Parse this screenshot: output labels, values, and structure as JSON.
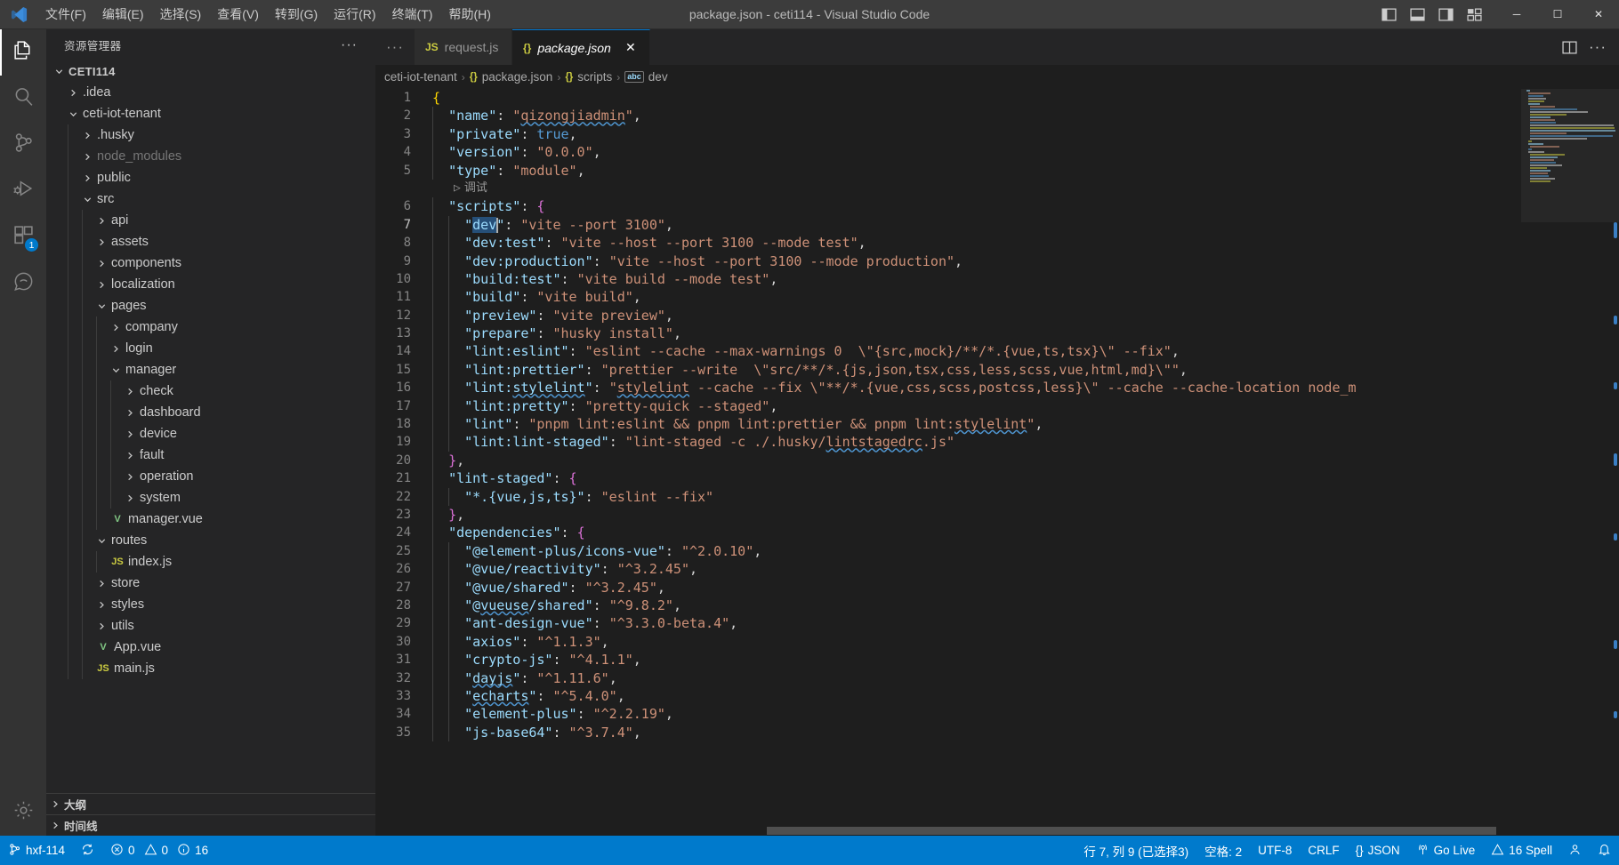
{
  "titlebar": {
    "logo_icon": "vscode-logo-icon",
    "menus": [
      "文件(F)",
      "编辑(E)",
      "选择(S)",
      "查看(V)",
      "转到(G)",
      "运行(R)",
      "终端(T)",
      "帮助(H)"
    ],
    "title": "package.json - ceti114 - Visual Studio Code",
    "layout_icons": [
      "toggle-primary-sidebar-icon",
      "toggle-panel-icon",
      "toggle-secondary-sidebar-icon",
      "customize-layout-icon"
    ],
    "window_controls": {
      "minimize": "─",
      "maximize": "☐",
      "close": "✕"
    }
  },
  "activitybar": {
    "items": [
      {
        "name": "explorer",
        "icon": "files-icon",
        "active": true,
        "badge": ""
      },
      {
        "name": "search",
        "icon": "search-icon",
        "active": false,
        "badge": ""
      },
      {
        "name": "source-control",
        "icon": "source-control-icon",
        "active": false,
        "badge": ""
      },
      {
        "name": "run-and-debug",
        "icon": "run-debug-icon",
        "active": false,
        "badge": ""
      },
      {
        "name": "extensions",
        "icon": "extensions-icon",
        "active": false,
        "badge": "1"
      },
      {
        "name": "copilot-chat",
        "icon": "copilot-icon",
        "active": false,
        "badge": ""
      }
    ],
    "bottom": [
      {
        "name": "manage",
        "icon": "gear-icon"
      }
    ]
  },
  "sidebar": {
    "header_title": "资源管理器",
    "more_actions": "···",
    "tree": [
      {
        "label": "CETI114",
        "depth": 0,
        "type": "root",
        "expanded": true
      },
      {
        "label": ".idea",
        "depth": 1,
        "type": "folder",
        "expanded": false
      },
      {
        "label": "ceti-iot-tenant",
        "depth": 1,
        "type": "folder",
        "expanded": true
      },
      {
        "label": ".husky",
        "depth": 2,
        "type": "folder",
        "expanded": false
      },
      {
        "label": "node_modules",
        "depth": 2,
        "type": "folder",
        "expanded": false,
        "dim": true
      },
      {
        "label": "public",
        "depth": 2,
        "type": "folder",
        "expanded": false
      },
      {
        "label": "src",
        "depth": 2,
        "type": "folder",
        "expanded": true
      },
      {
        "label": "api",
        "depth": 3,
        "type": "folder",
        "expanded": false
      },
      {
        "label": "assets",
        "depth": 3,
        "type": "folder",
        "expanded": false
      },
      {
        "label": "components",
        "depth": 3,
        "type": "folder",
        "expanded": false
      },
      {
        "label": "localization",
        "depth": 3,
        "type": "folder",
        "expanded": false
      },
      {
        "label": "pages",
        "depth": 3,
        "type": "folder",
        "expanded": true
      },
      {
        "label": "company",
        "depth": 4,
        "type": "folder",
        "expanded": false
      },
      {
        "label": "login",
        "depth": 4,
        "type": "folder",
        "expanded": false
      },
      {
        "label": "manager",
        "depth": 4,
        "type": "folder",
        "expanded": true
      },
      {
        "label": "check",
        "depth": 5,
        "type": "folder",
        "expanded": false
      },
      {
        "label": "dashboard",
        "depth": 5,
        "type": "folder",
        "expanded": false
      },
      {
        "label": "device",
        "depth": 5,
        "type": "folder",
        "expanded": false
      },
      {
        "label": "fault",
        "depth": 5,
        "type": "folder",
        "expanded": false
      },
      {
        "label": "operation",
        "depth": 5,
        "type": "folder",
        "expanded": false
      },
      {
        "label": "system",
        "depth": 5,
        "type": "folder",
        "expanded": false
      },
      {
        "label": "manager.vue",
        "depth": 4,
        "type": "vue"
      },
      {
        "label": "routes",
        "depth": 3,
        "type": "folder",
        "expanded": true
      },
      {
        "label": "index.js",
        "depth": 4,
        "type": "js"
      },
      {
        "label": "store",
        "depth": 3,
        "type": "folder",
        "expanded": false
      },
      {
        "label": "styles",
        "depth": 3,
        "type": "folder",
        "expanded": false
      },
      {
        "label": "utils",
        "depth": 3,
        "type": "folder",
        "expanded": false
      },
      {
        "label": "App.vue",
        "depth": 3,
        "type": "vue"
      },
      {
        "label": "main.js",
        "depth": 3,
        "type": "js"
      }
    ],
    "sections": [
      {
        "label": "大纲",
        "expanded": false
      },
      {
        "label": "时间线",
        "expanded": false
      }
    ]
  },
  "tabs": {
    "items": [
      {
        "label": "request.js",
        "icon": "js-file-icon",
        "active": false,
        "italic": false,
        "closable": false
      },
      {
        "label": "package.json",
        "icon": "json-file-icon",
        "active": true,
        "italic": true,
        "closable": true
      }
    ],
    "overflow": "···",
    "actions": [
      "split-editor-icon",
      "more-actions-icon"
    ]
  },
  "breadcrumb": {
    "segments": [
      {
        "label": "ceti-iot-tenant",
        "icon": ""
      },
      {
        "label": "package.json",
        "icon": "{}"
      },
      {
        "label": "scripts",
        "icon": "{}"
      },
      {
        "label": "dev",
        "icon": "abc"
      }
    ],
    "separator": "›"
  },
  "editor": {
    "codelens": {
      "label": "调试",
      "icon": "play-icon",
      "after_line": 5
    },
    "cursor": {
      "line": 7,
      "column": 9
    },
    "lines": [
      {
        "n": 1,
        "html": "<span class='br1'>{</span>"
      },
      {
        "n": 2,
        "html": "  <span class='k'>\"name\"</span><span class='p'>:</span> <span class='s'>\"<span class='sq'>qizongjiadmin</span>\"</span><span class='p'>,</span>"
      },
      {
        "n": 3,
        "html": "  <span class='k'>\"private\"</span><span class='p'>:</span> <span class='b'>true</span><span class='p'>,</span>"
      },
      {
        "n": 4,
        "html": "  <span class='k'>\"version\"</span><span class='p'>:</span> <span class='s'>\"0.0.0\"</span><span class='p'>,</span>"
      },
      {
        "n": 5,
        "html": "  <span class='k'>\"type\"</span><span class='p'>:</span> <span class='s'>\"module\"</span><span class='p'>,</span>"
      },
      {
        "n": 6,
        "html": "  <span class='k'>\"scripts\"</span><span class='p'>:</span> <span class='br2'>{</span>"
      },
      {
        "n": 7,
        "html": "    <span class='k'>\"<span class='sel'>dev</span>\"</span><span class='p'>:</span> <span class='s'>\"vite --port 3100\"</span><span class='p'>,</span>"
      },
      {
        "n": 8,
        "html": "    <span class='k'>\"dev:test\"</span><span class='p'>:</span> <span class='s'>\"vite --host --port 3100 --mode test\"</span><span class='p'>,</span>"
      },
      {
        "n": 9,
        "html": "    <span class='k'>\"dev:production\"</span><span class='p'>:</span> <span class='s'>\"vite --host --port 3100 --mode production\"</span><span class='p'>,</span>"
      },
      {
        "n": 10,
        "html": "    <span class='k'>\"build:test\"</span><span class='p'>:</span> <span class='s'>\"vite build --mode test\"</span><span class='p'>,</span>"
      },
      {
        "n": 11,
        "html": "    <span class='k'>\"build\"</span><span class='p'>:</span> <span class='s'>\"vite build\"</span><span class='p'>,</span>"
      },
      {
        "n": 12,
        "html": "    <span class='k'>\"preview\"</span><span class='p'>:</span> <span class='s'>\"vite preview\"</span><span class='p'>,</span>"
      },
      {
        "n": 13,
        "html": "    <span class='k'>\"prepare\"</span><span class='p'>:</span> <span class='s'>\"husky install\"</span><span class='p'>,</span>"
      },
      {
        "n": 14,
        "html": "    <span class='k'>\"lint:eslint\"</span><span class='p'>:</span> <span class='s'>\"eslint --cache --max-warnings 0  \\\"{src,mock}/**/*.{vue,ts,tsx}\\\" --fix\"</span><span class='p'>,</span>"
      },
      {
        "n": 15,
        "html": "    <span class='k'>\"lint:prettier\"</span><span class='p'>:</span> <span class='s'>\"prettier --write  \\\"src/**/*.{js,json,tsx,css,less,scss,vue,html,md}\\\"\"</span><span class='p'>,</span>"
      },
      {
        "n": 16,
        "html": "    <span class='k'>\"lint:<span class='sq'>stylelint</span>\"</span><span class='p'>:</span> <span class='s'>\"<span class='sq'>stylelint</span> --cache --fix \\\"**/*.{vue,css,scss,postcss,less}\\\" --cache --cache-location node_m</span>"
      },
      {
        "n": 17,
        "html": "    <span class='k'>\"lint:pretty\"</span><span class='p'>:</span> <span class='s'>\"pretty-quick --staged\"</span><span class='p'>,</span>"
      },
      {
        "n": 18,
        "html": "    <span class='k'>\"lint\"</span><span class='p'>:</span> <span class='s'>\"pnpm lint:eslint &amp;&amp; pnpm lint:prettier &amp;&amp; pnpm lint:<span class='sq'>stylelint</span>\"</span><span class='p'>,</span>"
      },
      {
        "n": 19,
        "html": "    <span class='k'>\"lint:lint-staged\"</span><span class='p'>:</span> <span class='s'>\"lint-staged -c ./.husky/<span class='sq'>lintstagedrc</span>.js\"</span>"
      },
      {
        "n": 20,
        "html": "  <span class='br2'>}</span><span class='p'>,</span>"
      },
      {
        "n": 21,
        "html": "  <span class='k'>\"lint-staged\"</span><span class='p'>:</span> <span class='br2'>{</span>"
      },
      {
        "n": 22,
        "html": "    <span class='k'>\"*.{vue,js,ts}\"</span><span class='p'>:</span> <span class='s'>\"eslint --fix\"</span>"
      },
      {
        "n": 23,
        "html": "  <span class='br2'>}</span><span class='p'>,</span>"
      },
      {
        "n": 24,
        "html": "  <span class='k'>\"dependencies\"</span><span class='p'>:</span> <span class='br2'>{</span>"
      },
      {
        "n": 25,
        "html": "    <span class='k'>\"@element-plus/icons-vue\"</span><span class='p'>:</span> <span class='s'>\"^2.0.10\"</span><span class='p'>,</span>"
      },
      {
        "n": 26,
        "html": "    <span class='k'>\"@vue/reactivity\"</span><span class='p'>:</span> <span class='s'>\"^3.2.45\"</span><span class='p'>,</span>"
      },
      {
        "n": 27,
        "html": "    <span class='k'>\"@vue/shared\"</span><span class='p'>:</span> <span class='s'>\"^3.2.45\"</span><span class='p'>,</span>"
      },
      {
        "n": 28,
        "html": "    <span class='k'>\"@<span class='sq'>vueuse</span>/shared\"</span><span class='p'>:</span> <span class='s'>\"^9.8.2\"</span><span class='p'>,</span>"
      },
      {
        "n": 29,
        "html": "    <span class='k'>\"ant-design-vue\"</span><span class='p'>:</span> <span class='s'>\"^3.3.0-beta.4\"</span><span class='p'>,</span>"
      },
      {
        "n": 30,
        "html": "    <span class='k'>\"axios\"</span><span class='p'>:</span> <span class='s'>\"^1.1.3\"</span><span class='p'>,</span>"
      },
      {
        "n": 31,
        "html": "    <span class='k'>\"crypto-js\"</span><span class='p'>:</span> <span class='s'>\"^4.1.1\"</span><span class='p'>,</span>"
      },
      {
        "n": 32,
        "html": "    <span class='k'>\"<span class='sq'>dayjs</span>\"</span><span class='p'>:</span> <span class='s'>\"^1.11.6\"</span><span class='p'>,</span>"
      },
      {
        "n": 33,
        "html": "    <span class='k'>\"<span class='sq'>echarts</span>\"</span><span class='p'>:</span> <span class='s'>\"^5.4.0\"</span><span class='p'>,</span>"
      },
      {
        "n": 34,
        "html": "    <span class='k'>\"element-plus\"</span><span class='p'>:</span> <span class='s'>\"^2.2.19\"</span><span class='p'>,</span>"
      },
      {
        "n": 35,
        "html": "    <span class='k'>\"js-base64\"</span><span class='p'>:</span> <span class='s'>\"^3.7.4\"</span><span class='p'>,</span>"
      }
    ]
  },
  "statusbar": {
    "left": [
      {
        "name": "remote-branch",
        "icon": "source-control-icon",
        "label": "hxf-114"
      },
      {
        "name": "sync",
        "icon": "sync-icon",
        "label": ""
      },
      {
        "name": "problems",
        "icon": "error-warning-info",
        "label": "0  0  16",
        "errors": "0",
        "warnings": "0",
        "infos": "16"
      }
    ],
    "right": [
      {
        "name": "editor-position",
        "label": "行 7, 列 9 (已选择3)"
      },
      {
        "name": "indentation",
        "label": "空格: 2"
      },
      {
        "name": "encoding",
        "label": "UTF-8"
      },
      {
        "name": "eol",
        "label": "CRLF"
      },
      {
        "name": "language-mode",
        "label": "JSON",
        "icon": "{}"
      },
      {
        "name": "go-live",
        "label": "Go Live",
        "icon": "broadcast-icon"
      },
      {
        "name": "spell-checker",
        "label": "16 Spell",
        "icon": "warning-icon"
      },
      {
        "name": "accounts",
        "label": "",
        "icon": "account-icon"
      },
      {
        "name": "notifications",
        "label": "",
        "icon": "bell-icon"
      }
    ]
  },
  "colors": {
    "accent": "#007acc",
    "titlebar_bg": "#3c3c3c",
    "sidebar_bg": "#252526",
    "editor_bg": "#1e1e1e",
    "activitybar_bg": "#333333"
  }
}
